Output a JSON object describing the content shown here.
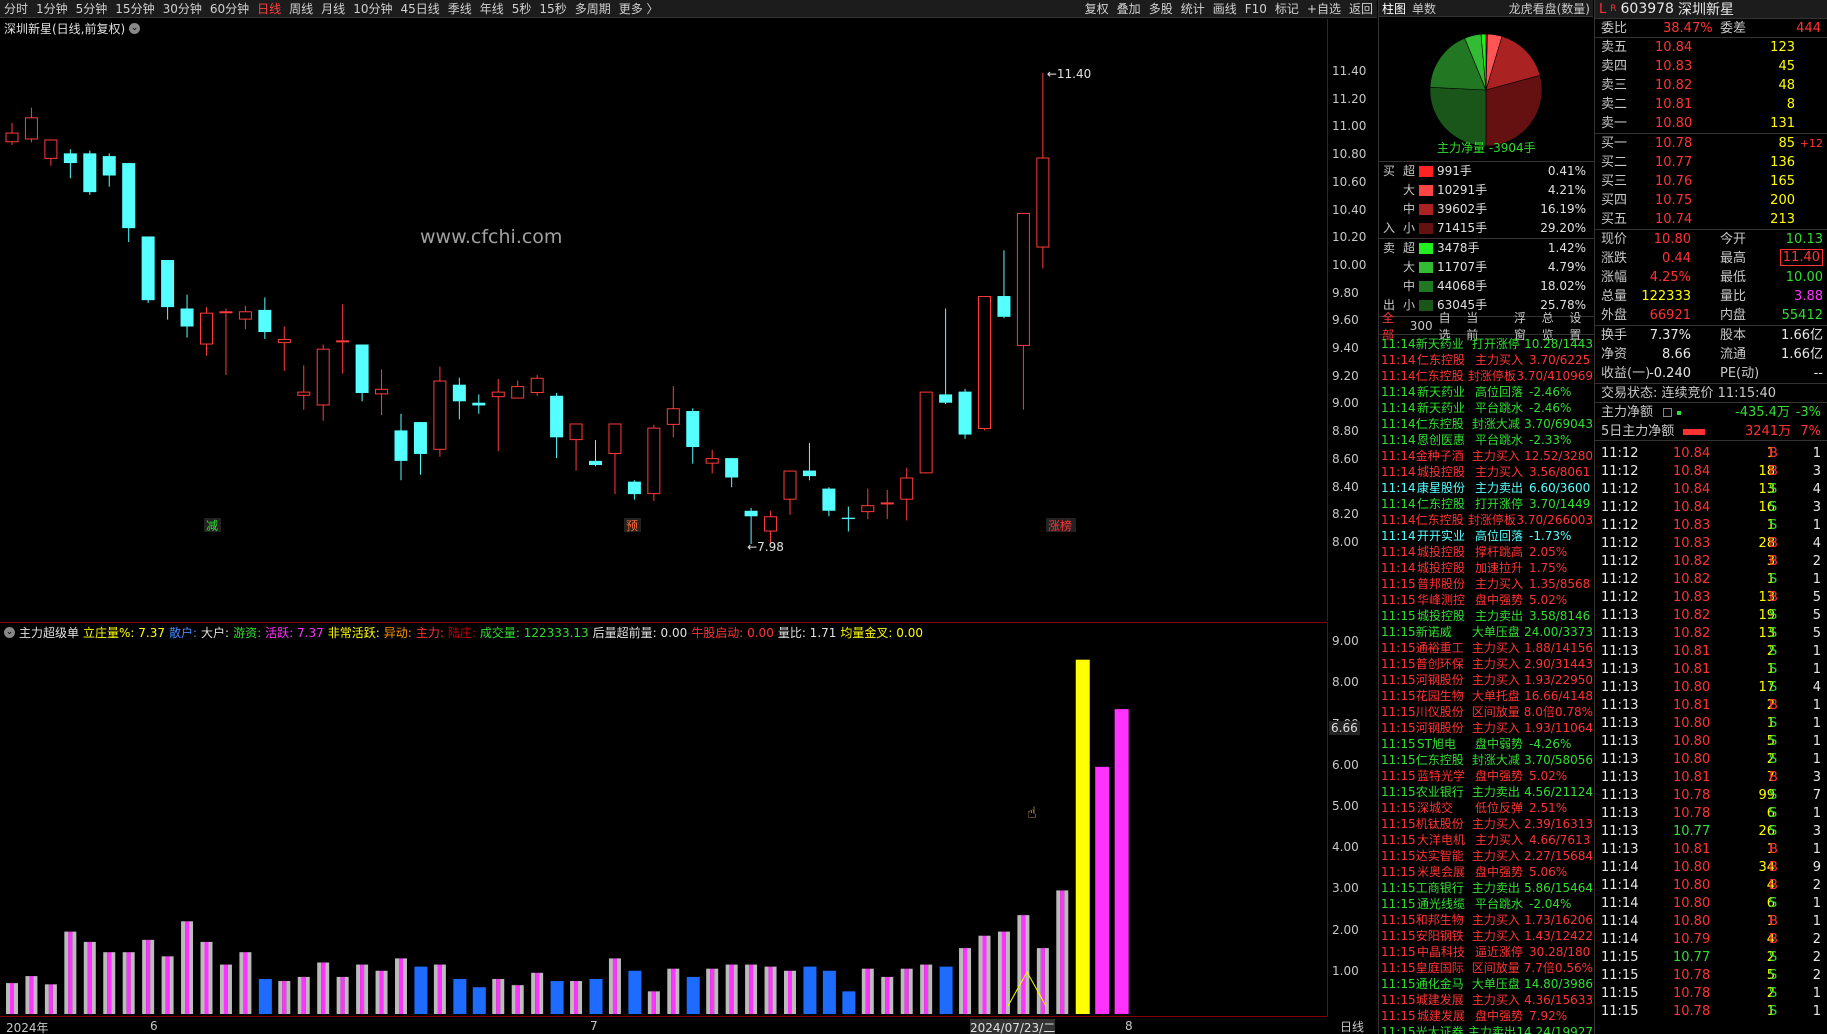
{
  "topbar": {
    "periods": [
      "分时",
      "1分钟",
      "5分钟",
      "15分钟",
      "30分钟",
      "60分钟",
      "日线",
      "周线",
      "月线",
      "10分钟",
      "45日线",
      "季线",
      "年线",
      "5秒",
      "15秒",
      "多周期",
      "更多 〉"
    ],
    "active": "日线",
    "tools": [
      "复权",
      "叠加",
      "多股",
      "统计",
      "画线",
      "F10",
      "标记",
      "+自选",
      "返回"
    ]
  },
  "chart": {
    "title": "深圳新星(日线,前复权)",
    "watermark": "www.cfchi.com",
    "high_label": "11.40",
    "low_label": "7.98",
    "price_ticks": [
      "11.40",
      "11.20",
      "11.00",
      "10.80",
      "10.60",
      "10.40",
      "10.20",
      "10.00",
      "9.80",
      "9.60",
      "9.40",
      "9.20",
      "9.00",
      "8.80",
      "8.60",
      "8.40",
      "8.20",
      "8.00"
    ],
    "signals": [
      {
        "label": "减",
        "color": "#33dd33"
      },
      {
        "label": "预",
        "color": "#ff6633"
      },
      {
        "label": "涨榜",
        "color": "#ff3333"
      }
    ],
    "candles": [
      [
        10.9,
        10.97,
        10.88,
        11.04
      ],
      [
        10.92,
        11.08,
        10.9,
        11.15
      ],
      [
        10.78,
        10.92,
        10.73,
        10.92
      ],
      [
        10.82,
        10.75,
        10.64,
        10.85
      ],
      [
        10.82,
        10.54,
        10.52,
        10.84
      ],
      [
        10.8,
        10.66,
        10.58,
        10.82
      ],
      [
        10.75,
        10.28,
        10.18,
        10.75
      ],
      [
        10.22,
        9.76,
        9.74,
        10.22
      ],
      [
        10.05,
        9.71,
        9.62,
        10.05
      ],
      [
        9.7,
        9.57,
        9.49,
        9.8
      ],
      [
        9.44,
        9.67,
        9.36,
        9.71
      ],
      [
        9.67,
        9.68,
        9.22,
        9.7
      ],
      [
        9.62,
        9.68,
        9.55,
        9.72
      ],
      [
        9.69,
        9.53,
        9.48,
        9.78
      ],
      [
        9.45,
        9.48,
        9.25,
        9.57
      ],
      [
        9.07,
        9.1,
        8.97,
        9.29
      ],
      [
        9.0,
        9.41,
        8.89,
        9.44
      ],
      [
        9.46,
        9.47,
        9.23,
        9.73
      ],
      [
        9.44,
        9.09,
        9.03,
        9.44
      ],
      [
        9.08,
        9.12,
        8.93,
        9.26
      ],
      [
        8.82,
        8.6,
        8.46,
        8.94
      ],
      [
        8.88,
        8.65,
        8.5,
        8.88
      ],
      [
        8.68,
        9.18,
        8.63,
        9.28
      ],
      [
        9.15,
        9.03,
        8.9,
        9.2
      ],
      [
        9.02,
        9.0,
        8.94,
        9.08
      ],
      [
        9.06,
        9.1,
        8.67,
        9.19
      ],
      [
        9.05,
        9.14,
        9.05,
        9.18
      ],
      [
        9.09,
        9.2,
        9.07,
        9.22
      ],
      [
        9.07,
        8.77,
        8.62,
        9.09
      ],
      [
        8.75,
        8.87,
        8.53,
        8.87
      ],
      [
        8.6,
        8.57,
        8.56,
        8.75
      ],
      [
        8.65,
        8.87,
        8.36,
        8.87
      ],
      [
        8.45,
        8.36,
        8.32,
        8.46
      ],
      [
        8.36,
        8.84,
        8.31,
        8.86
      ],
      [
        8.86,
        8.98,
        8.77,
        9.14
      ],
      [
        8.96,
        8.7,
        8.58,
        8.98
      ],
      [
        8.58,
        8.62,
        8.51,
        8.68
      ],
      [
        8.62,
        8.48,
        8.41,
        8.62
      ],
      [
        8.24,
        8.2,
        8.0,
        8.26
      ],
      [
        8.09,
        8.2,
        8.0,
        8.24
      ],
      [
        8.32,
        8.53,
        8.21,
        8.53
      ],
      [
        8.53,
        8.49,
        8.46,
        8.73
      ],
      [
        8.4,
        8.24,
        8.2,
        8.41
      ],
      [
        8.19,
        8.18,
        8.09,
        8.27
      ],
      [
        8.23,
        8.28,
        8.18,
        8.4
      ],
      [
        8.3,
        8.3,
        8.18,
        8.39
      ],
      [
        8.32,
        8.48,
        8.17,
        8.55
      ],
      [
        8.51,
        9.1,
        8.51,
        9.1
      ],
      [
        9.08,
        9.02,
        9.01,
        9.7
      ],
      [
        9.1,
        8.79,
        8.76,
        9.12
      ],
      [
        8.83,
        9.79,
        8.82,
        9.79
      ],
      [
        9.79,
        9.64,
        9.63,
        10.12
      ],
      [
        9.43,
        10.39,
        8.97,
        10.39
      ],
      [
        10.14,
        10.79,
        9.99,
        11.4
      ]
    ],
    "volumes": [
      0.75,
      0.92,
      0.72,
      2.0,
      1.75,
      1.5,
      1.5,
      1.8,
      1.4,
      2.25,
      1.75,
      1.2,
      1.5,
      0.85,
      0.8,
      0.9,
      1.25,
      0.9,
      1.2,
      1.05,
      1.35,
      1.15,
      1.2,
      0.85,
      0.65,
      0.85,
      0.7,
      1.0,
      0.8,
      0.8,
      0.85,
      1.35,
      1.05,
      0.55,
      1.1,
      0.9,
      1.1,
      1.2,
      1.2,
      1.15,
      1.05,
      1.15,
      1.05,
      0.55,
      1.1,
      0.9,
      1.1,
      1.2,
      1.15,
      1.6,
      1.9,
      2.0,
      2.4,
      1.6,
      3.0,
      8.6,
      6.0,
      7.4
    ],
    "vol_ticks": [
      "9.00",
      "8.00",
      "7.00",
      "6.00",
      "5.00",
      "4.00",
      "3.00",
      "2.00",
      "1.00"
    ],
    "vol_marker": "6.66",
    "dates": [
      "2024年",
      "6",
      "7",
      "2024/07/23/二",
      "8"
    ],
    "right_label": "日线"
  },
  "indicator": {
    "items": [
      {
        "k": "主力超级单",
        "c": "#e0e0e0"
      },
      {
        "k": "立庄量%: 7.37",
        "c": "#ffff00"
      },
      {
        "k": "散户:",
        "c": "#4488ff"
      },
      {
        "k": "大户:",
        "c": "#e0e0e0"
      },
      {
        "k": "游资:",
        "c": "#33dd33"
      },
      {
        "k": "活跃: 7.37",
        "c": "#ff33ff"
      },
      {
        "k": "非常活跃:",
        "c": "#ffff00"
      },
      {
        "k": "异动:",
        "c": "#ff9900"
      },
      {
        "k": "主力:",
        "c": "#ff3333"
      },
      {
        "k": "陆庄:",
        "c": "#c00000"
      },
      {
        "k": "成交量: 122333.13",
        "c": "#33dd33"
      },
      {
        "k": "后量超前量: 0.00",
        "c": "#e0e0e0"
      },
      {
        "k": "牛股启动: 0.00",
        "c": "#ff3333"
      },
      {
        "k": "量比: 1.71",
        "c": "#e0e0e0"
      },
      {
        "k": "均量金叉: 0.00",
        "c": "#ffff00"
      }
    ]
  },
  "mid": {
    "tabs": [
      "柱图",
      "单数"
    ],
    "dragon": "龙虎看盘(数量)",
    "net": "主力净量 -3904手",
    "buy": {
      "side": "买",
      "side2": "入",
      "rows": [
        {
          "s": "超",
          "v": "991手",
          "p": "0.41%",
          "c": "#ff2222"
        },
        {
          "s": "大",
          "v": "10291手",
          "p": "4.21%",
          "c": "#ff4444"
        },
        {
          "s": "中",
          "v": "39602手",
          "p": "16.19%",
          "c": "#aa2222"
        },
        {
          "s": "小",
          "v": "71415手",
          "p": "29.20%",
          "c": "#661111"
        }
      ]
    },
    "sell": {
      "side": "卖",
      "side2": "出",
      "rows": [
        {
          "s": "超",
          "v": "3478手",
          "p": "1.42%",
          "c": "#22ee22"
        },
        {
          "s": "大",
          "v": "11707手",
          "p": "4.79%",
          "c": "#33bb33"
        },
        {
          "s": "中",
          "v": "44068手",
          "p": "18.02%",
          "c": "#227722"
        },
        {
          "s": "小",
          "v": "63045手",
          "p": "25.78%",
          "c": "#1a551a"
        }
      ]
    },
    "news_tabs": [
      "全部",
      "300",
      "自选",
      "当前",
      "浮窗",
      "总览",
      "设置"
    ],
    "news": [
      [
        "11:14",
        "新天药业",
        "打开涨停",
        "10.28/1443",
        "g"
      ],
      [
        "11:14",
        "仁东控股",
        "主力买入",
        "3.70/6225",
        "r"
      ],
      [
        "11:14",
        "仁东控股",
        "封涨停板",
        "3.70/410969",
        "r"
      ],
      [
        "11:14",
        "新天药业",
        "高位回落",
        "-2.46%",
        "g"
      ],
      [
        "11:14",
        "新天药业",
        "平台跳水",
        "-2.46%",
        "g"
      ],
      [
        "11:14",
        "仁东控股",
        "封涨大减",
        "3.70/69043",
        "g"
      ],
      [
        "11:14",
        "恩创医惠",
        "平台跳水",
        "-2.33%",
        "g"
      ],
      [
        "11:14",
        "金种子酒",
        "主力买入",
        "12.52/3280",
        "r"
      ],
      [
        "11:14",
        "城投控股",
        "主力买入",
        "3.56/8061",
        "r"
      ],
      [
        "11:14",
        "康星股份",
        "主力卖出",
        "6.60/3600",
        "c"
      ],
      [
        "11:14",
        "仁东控股",
        "打开涨停",
        "3.70/1449",
        "g"
      ],
      [
        "11:14",
        "仁东控股",
        "封涨停板",
        "3.70/266003",
        "r"
      ],
      [
        "11:14",
        "开开实业",
        "高位回落",
        "-1.73%",
        "c"
      ],
      [
        "11:14",
        "城投控股",
        "撑杆跳高",
        "2.05%",
        "r"
      ],
      [
        "11:14",
        "城投控股",
        "加速拉升",
        "1.75%",
        "r"
      ],
      [
        "11:15",
        "普邦股份",
        "主力买入",
        "1.35/8568",
        "r"
      ],
      [
        "11:15",
        "华峰测控",
        "盘中强势",
        "5.02%",
        "r"
      ],
      [
        "11:15",
        "城投控股",
        "主力卖出",
        "3.58/8146",
        "g"
      ],
      [
        "11:15",
        "新诺威",
        "大单压盘",
        "24.00/3373",
        "g"
      ],
      [
        "11:15",
        "通裕重工",
        "主力买入",
        "1.88/14156",
        "r"
      ],
      [
        "11:15",
        "普创环保",
        "主力买入",
        "2.90/31443",
        "r"
      ],
      [
        "11:15",
        "河钢股份",
        "主力买入",
        "1.93/22950",
        "r"
      ],
      [
        "11:15",
        "花园生物",
        "大单托盘",
        "16.66/4148",
        "r"
      ],
      [
        "11:15",
        "川仪股份",
        "区间放量",
        "8.0倍0.78%",
        "r"
      ],
      [
        "11:15",
        "河钢股份",
        "主力买入",
        "1.93/11064",
        "r"
      ],
      [
        "11:15",
        "ST旭电",
        "盘中弱势",
        "-4.26%",
        "g"
      ],
      [
        "11:15",
        "仁东控股",
        "封涨大减",
        "3.70/58056",
        "g"
      ],
      [
        "11:15",
        "蓝特光学",
        "盘中强势",
        "5.02%",
        "r"
      ],
      [
        "11:15",
        "农业银行",
        "主力卖出",
        "4.56/21124",
        "g"
      ],
      [
        "11:15",
        "深城交",
        "低位反弹",
        "2.51%",
        "r"
      ],
      [
        "11:15",
        "机钛股份",
        "主力买入",
        "2.39/16313",
        "r"
      ],
      [
        "11:15",
        "大洋电机",
        "主力买入",
        "4.66/7613",
        "r"
      ],
      [
        "11:15",
        "达实智能",
        "主力买入",
        "2.27/15684",
        "r"
      ],
      [
        "11:15",
        "米奥会展",
        "盘中强势",
        "5.06%",
        "r"
      ],
      [
        "11:15",
        "工商银行",
        "主力卖出",
        "5.86/15464",
        "g"
      ],
      [
        "11:15",
        "通光线缆",
        "平台跳水",
        "-2.04%",
        "g"
      ],
      [
        "11:15",
        "和邦生物",
        "主力买入",
        "1.73/16206",
        "r"
      ],
      [
        "11:15",
        "安阳钢铁",
        "主力买入",
        "1.43/12422",
        "r"
      ],
      [
        "11:15",
        "中晶科技",
        "逼近涨停",
        "30.28/180",
        "r"
      ],
      [
        "11:15",
        "皇庭国际",
        "区间放量",
        "7.7倍0.56%",
        "r"
      ],
      [
        "11:15",
        "通化金马",
        "大单压盘",
        "14.80/3986",
        "g"
      ],
      [
        "11:15",
        "城建发展",
        "主力买入",
        "4.36/15633",
        "r"
      ],
      [
        "11:15",
        "城建发展",
        "盘中强势",
        "7.92%",
        "r"
      ],
      [
        "11:15",
        "光大证券",
        "主力卖出",
        "14.24/19927",
        "g"
      ]
    ]
  },
  "right": {
    "code": "603978",
    "name": "深圳新星",
    "weibi_label": "委比",
    "weibi": "38.47%",
    "weicha_label": "委差",
    "weicha": "444",
    "asks": [
      {
        "l": "卖五",
        "p": "10.84",
        "v": "123"
      },
      {
        "l": "卖四",
        "p": "10.83",
        "v": "45"
      },
      {
        "l": "卖三",
        "p": "10.82",
        "v": "48"
      },
      {
        "l": "卖二",
        "p": "10.81",
        "v": "8"
      },
      {
        "l": "卖一",
        "p": "10.80",
        "v": "131"
      }
    ],
    "bids": [
      {
        "l": "买一",
        "p": "10.78",
        "v": "85",
        "x": "+12"
      },
      {
        "l": "买二",
        "p": "10.77",
        "v": "136",
        "x": ""
      },
      {
        "l": "买三",
        "p": "10.76",
        "v": "165",
        "x": ""
      },
      {
        "l": "买四",
        "p": "10.75",
        "v": "200",
        "x": ""
      },
      {
        "l": "买五",
        "p": "10.74",
        "v": "213",
        "x": ""
      }
    ],
    "stats": [
      [
        {
          "k": "现价",
          "v": "10.80",
          "c": "red"
        },
        {
          "k": "今开",
          "v": "10.13",
          "c": "green"
        }
      ],
      [
        {
          "k": "涨跌",
          "v": "0.44",
          "c": "red"
        },
        {
          "k": "最高",
          "v": "11.40",
          "c": "red"
        }
      ],
      [
        {
          "k": "涨幅",
          "v": "4.25%",
          "c": "red"
        },
        {
          "k": "最低",
          "v": "10.00",
          "c": "green"
        }
      ],
      [
        {
          "k": "总量",
          "v": "122333",
          "c": "yellow"
        },
        {
          "k": "量比",
          "v": "3.88",
          "c": "magenta"
        }
      ],
      [
        {
          "k": "外盘",
          "v": "66921",
          "c": "red"
        },
        {
          "k": "内盘",
          "v": "55412",
          "c": "green"
        }
      ]
    ],
    "stats2": [
      [
        {
          "k": "换手",
          "v": "7.37%",
          "c": "white"
        },
        {
          "k": "股本",
          "v": "1.66亿",
          "c": "white"
        }
      ],
      [
        {
          "k": "净资",
          "v": "8.66",
          "c": "white"
        },
        {
          "k": "流通",
          "v": "1.66亿",
          "c": "white"
        }
      ],
      [
        {
          "k": "收益(一)",
          "v": "-0.240",
          "c": "white"
        },
        {
          "k": "PE(动)",
          "v": "--",
          "c": "white"
        }
      ]
    ],
    "status": "交易状态: 连续竞价 11:15:40",
    "zl_label": "主力净额",
    "zl_val": "-435.4万",
    "zl_pct": "-3%",
    "zl5_label": "5日主力净额",
    "zl5_val": "3241万",
    "zl5_pct": "7%",
    "ticks": [
      [
        "11:12",
        "10.84",
        "1",
        "B",
        "1"
      ],
      [
        "11:12",
        "10.84",
        "18",
        "B",
        "3"
      ],
      [
        "11:12",
        "10.84",
        "13",
        "S",
        "4"
      ],
      [
        "11:12",
        "10.84",
        "16",
        "S",
        "3"
      ],
      [
        "11:12",
        "10.83",
        "1",
        "S",
        "1"
      ],
      [
        "11:12",
        "10.83",
        "28",
        "B",
        "4"
      ],
      [
        "11:12",
        "10.82",
        "3",
        "B",
        "2"
      ],
      [
        "11:12",
        "10.82",
        "1",
        "S",
        "1"
      ],
      [
        "11:12",
        "10.83",
        "13",
        "B",
        "5"
      ],
      [
        "11:13",
        "10.82",
        "19",
        "S",
        "5"
      ],
      [
        "11:13",
        "10.82",
        "13",
        "S",
        "5"
      ],
      [
        "11:13",
        "10.81",
        "2",
        "S",
        "1"
      ],
      [
        "11:13",
        "10.81",
        "1",
        "S",
        "1"
      ],
      [
        "11:13",
        "10.80",
        "17",
        "S",
        "4"
      ],
      [
        "11:13",
        "10.81",
        "2",
        "B",
        "1"
      ],
      [
        "11:13",
        "10.80",
        "1",
        "S",
        "1"
      ],
      [
        "11:13",
        "10.80",
        "5",
        "S",
        "1"
      ],
      [
        "11:13",
        "10.80",
        "2",
        "S",
        "1"
      ],
      [
        "11:13",
        "10.81",
        "7",
        "B",
        "3"
      ],
      [
        "11:13",
        "10.78",
        "99",
        "S",
        "7"
      ],
      [
        "11:13",
        "10.78",
        "6",
        "S",
        "1"
      ],
      [
        "11:13",
        "10.77",
        "26",
        "S",
        "3"
      ],
      [
        "11:13",
        "10.81",
        "1",
        "B",
        "1"
      ],
      [
        "11:14",
        "10.80",
        "34",
        "B",
        "9"
      ],
      [
        "11:14",
        "10.80",
        "4",
        "B",
        "2"
      ],
      [
        "11:14",
        "10.80",
        "6",
        "S",
        "1"
      ],
      [
        "11:14",
        "10.80",
        "1",
        "B",
        "1"
      ],
      [
        "11:14",
        "10.79",
        "4",
        "B",
        "2"
      ],
      [
        "11:15",
        "10.77",
        "2",
        "S",
        "2"
      ],
      [
        "11:15",
        "10.78",
        "5",
        "S",
        "2"
      ],
      [
        "11:15",
        "10.78",
        "2",
        "S",
        "1"
      ],
      [
        "11:15",
        "10.78",
        "1",
        "S",
        "1"
      ]
    ]
  }
}
